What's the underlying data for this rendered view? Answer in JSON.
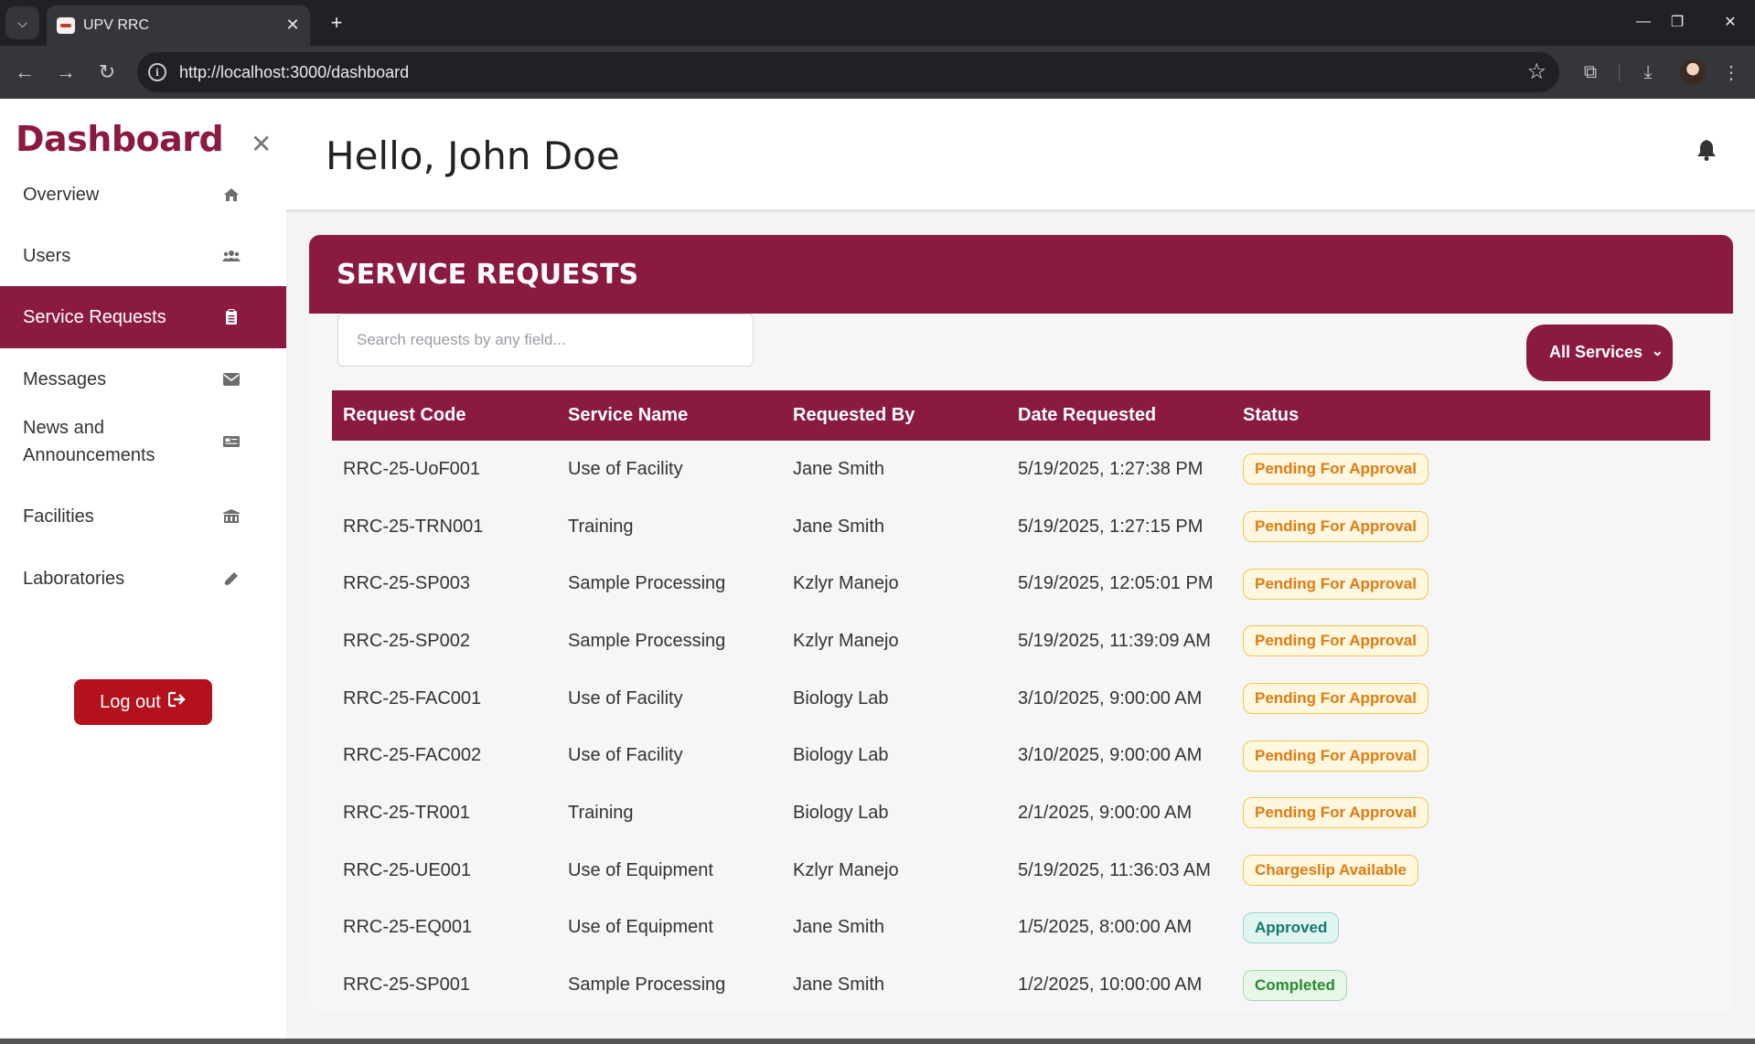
{
  "browser": {
    "tab_title": "UPV RRC",
    "url": "http://localhost:3000/dashboard"
  },
  "sidebar": {
    "brand": "Dashboard",
    "items": [
      {
        "label": "Overview",
        "icon": "home-icon"
      },
      {
        "label": "Users",
        "icon": "users-icon"
      },
      {
        "label": "Service Requests",
        "icon": "clipboard-icon",
        "active": true
      },
      {
        "label": "Messages",
        "icon": "envelope-icon"
      },
      {
        "label": "News and Announcements",
        "icon": "newspaper-icon"
      },
      {
        "label": "Facilities",
        "icon": "building-icon"
      },
      {
        "label": "Laboratories",
        "icon": "flask-icon"
      }
    ],
    "logout_label": "Log out"
  },
  "header": {
    "greeting": "Hello, John Doe"
  },
  "service_requests": {
    "title": "SERVICE REQUESTS",
    "search_placeholder": "Search requests by any field...",
    "filter_selected": "All Services",
    "columns": [
      "Request Code",
      "Service Name",
      "Requested By",
      "Date Requested",
      "Status"
    ],
    "rows": [
      {
        "code": "RRC-25-UoF001",
        "service": "Use of Facility",
        "requested_by": "Jane Smith",
        "date": "5/19/2025, 1:27:38 PM",
        "status": "Pending For Approval",
        "status_type": "pending"
      },
      {
        "code": "RRC-25-TRN001",
        "service": "Training",
        "requested_by": "Jane Smith",
        "date": "5/19/2025, 1:27:15 PM",
        "status": "Pending For Approval",
        "status_type": "pending"
      },
      {
        "code": "RRC-25-SP003",
        "service": "Sample Processing",
        "requested_by": "Kzlyr Manejo",
        "date": "5/19/2025, 12:05:01 PM",
        "status": "Pending For Approval",
        "status_type": "pending"
      },
      {
        "code": "RRC-25-SP002",
        "service": "Sample Processing",
        "requested_by": "Kzlyr Manejo",
        "date": "5/19/2025, 11:39:09 AM",
        "status": "Pending For Approval",
        "status_type": "pending"
      },
      {
        "code": "RRC-25-FAC001",
        "service": "Use of Facility",
        "requested_by": "Biology Lab",
        "date": "3/10/2025, 9:00:00 AM",
        "status": "Pending For Approval",
        "status_type": "pending"
      },
      {
        "code": "RRC-25-FAC002",
        "service": "Use of Facility",
        "requested_by": "Biology Lab",
        "date": "3/10/2025, 9:00:00 AM",
        "status": "Pending For Approval",
        "status_type": "pending"
      },
      {
        "code": "RRC-25-TR001",
        "service": "Training",
        "requested_by": "Biology Lab",
        "date": "2/1/2025, 9:00:00 AM",
        "status": "Pending For Approval",
        "status_type": "pending"
      },
      {
        "code": "RRC-25-UE001",
        "service": "Use of Equipment",
        "requested_by": "Kzlyr Manejo",
        "date": "5/19/2025, 11:36:03 AM",
        "status": "Chargeslip Available",
        "status_type": "chargeslip"
      },
      {
        "code": "RRC-25-EQ001",
        "service": "Use of Equipment",
        "requested_by": "Jane Smith",
        "date": "1/5/2025, 8:00:00 AM",
        "status": "Approved",
        "status_type": "approved"
      },
      {
        "code": "RRC-25-SP001",
        "service": "Sample Processing",
        "requested_by": "Jane Smith",
        "date": "1/2/2025, 10:00:00 AM",
        "status": "Completed",
        "status_type": "completed"
      }
    ]
  },
  "colors": {
    "brand": "#8b1a3f",
    "logout": "#b3121d",
    "pending": "#e07b10",
    "approved": "#137a6b",
    "completed": "#2a8a35"
  }
}
